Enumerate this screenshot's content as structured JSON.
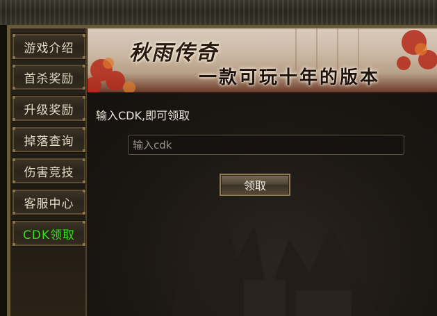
{
  "sidebar": {
    "items": [
      {
        "label": "游戏介绍"
      },
      {
        "label": "首杀奖励"
      },
      {
        "label": "升级奖励"
      },
      {
        "label": "掉落查询"
      },
      {
        "label": "伤害竞技"
      },
      {
        "label": "客服中心"
      },
      {
        "label": "CDK领取",
        "active": true
      }
    ],
    "active_color": "#34e01c"
  },
  "banner": {
    "title": "秋雨传奇",
    "subtitle": "一款可玩十年的版本"
  },
  "main": {
    "prompt": "输入CDK,即可领取",
    "cdk_placeholder": "输入cdk",
    "claim_label": "领取"
  }
}
